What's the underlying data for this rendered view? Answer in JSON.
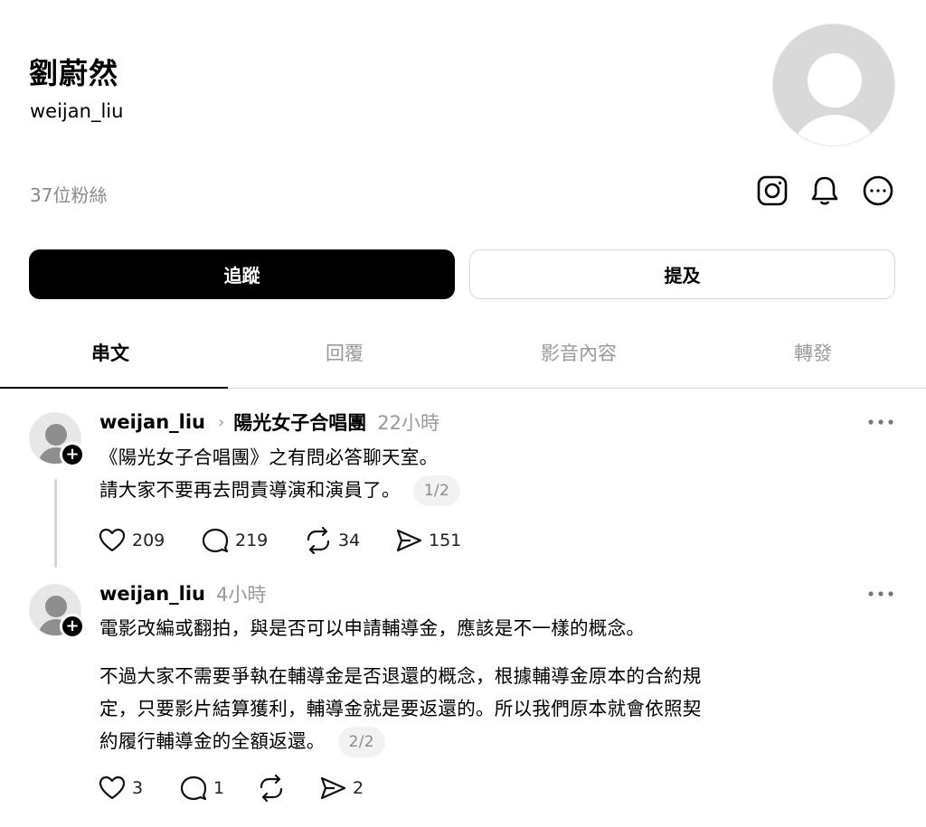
{
  "profile": {
    "name": "劉蔚然",
    "handle": "weijan_liu",
    "followers": "37位粉絲"
  },
  "buttons": {
    "follow": "追蹤",
    "mention": "提及"
  },
  "tabs": [
    {
      "label": "串文",
      "active": true
    },
    {
      "label": "回覆",
      "active": false
    },
    {
      "label": "影音內容",
      "active": false
    },
    {
      "label": "轉發",
      "active": false
    }
  ],
  "icons": {
    "instagram": "instagram-icon",
    "notifications": "bell-icon",
    "more": "more-icon"
  },
  "posts": [
    {
      "user": "weijan_liu",
      "group": "陽光女子合唱團",
      "time": "22小時",
      "lines": [
        "《陽光女子合唱團》之有問必答聊天室。",
        "請大家不要再去問責導演和演員了。"
      ],
      "page": "1/2",
      "likes": "209",
      "replies": "219",
      "reposts": "34",
      "shares": "151"
    },
    {
      "user": "weijan_liu",
      "time": "4小時",
      "paragraph1": "電影改編或翻拍，與是否可以申請輔導金，應該是不一樣的概念。",
      "paragraph2_lines": [
        "不過大家不需要爭執在輔導金是否退還的概念，根據輔導金原本的合約規",
        "定，只要影片結算獲利，輔導金就是要返還的。所以我們原本就會依照契",
        "約履行輔導金的全額返還。"
      ],
      "page": "2/2",
      "likes": "3",
      "replies": "1",
      "reposts": "",
      "shares": "2"
    }
  ]
}
